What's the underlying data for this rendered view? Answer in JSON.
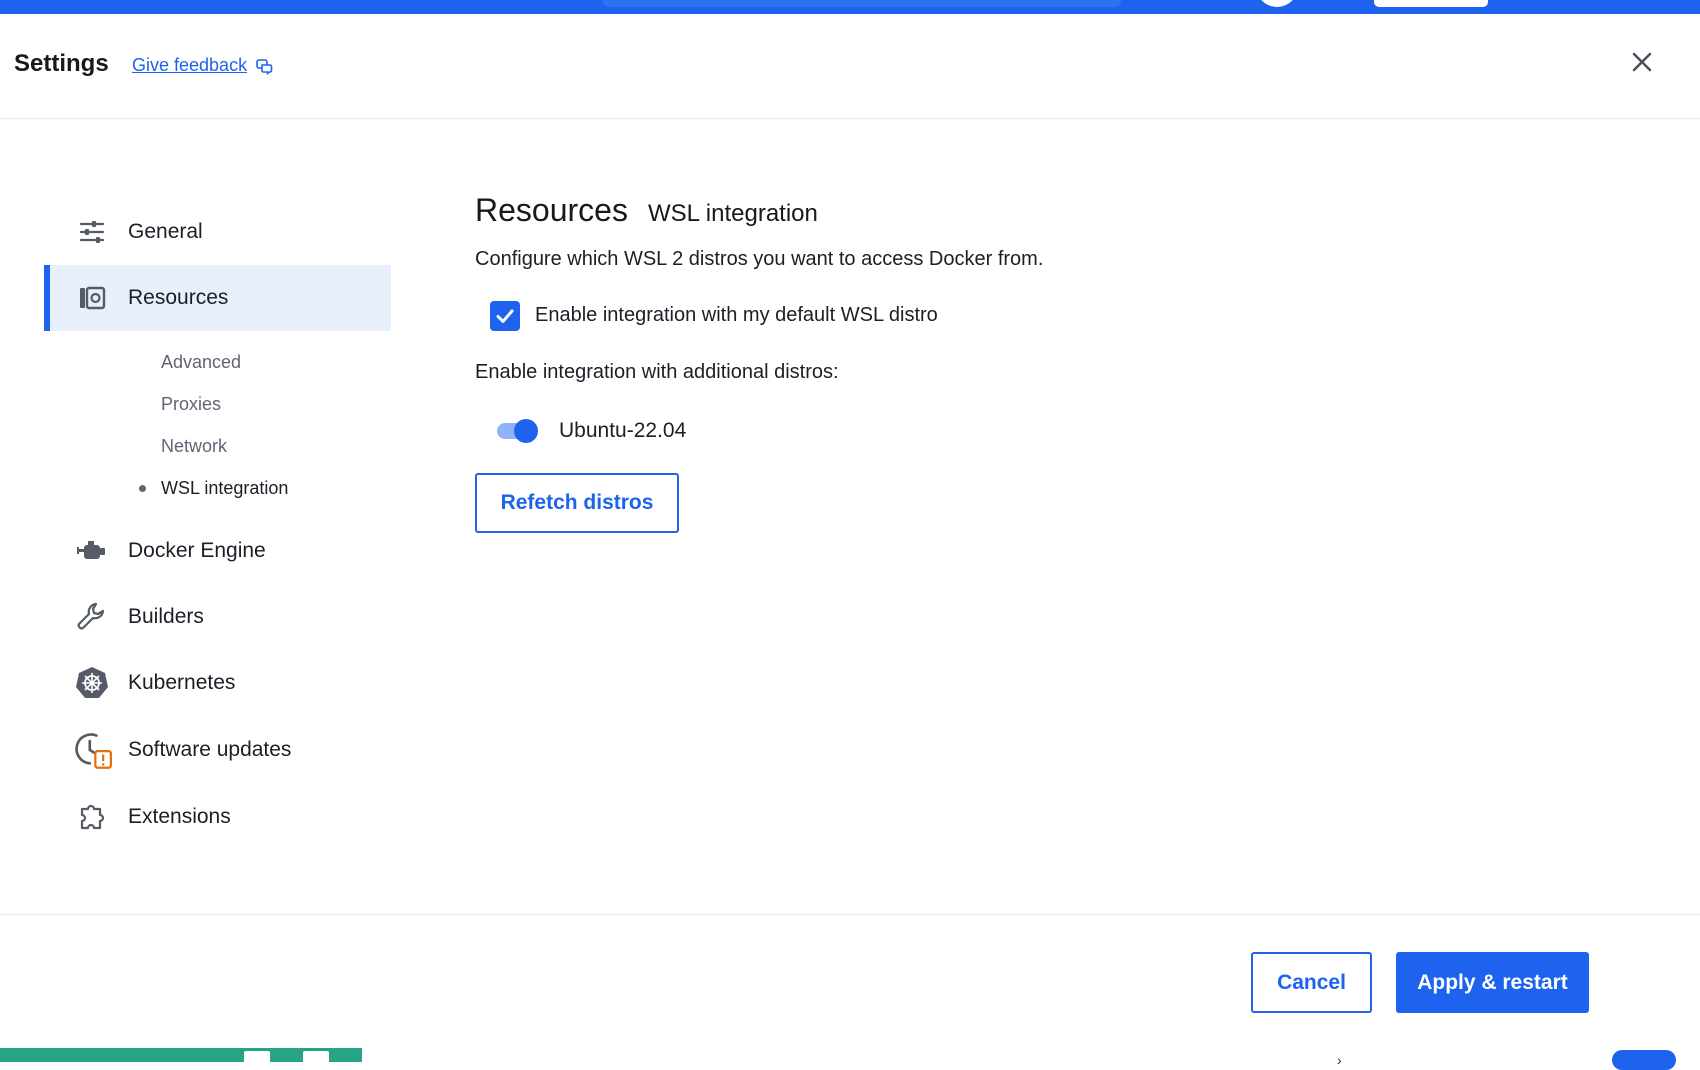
{
  "header": {
    "title": "Settings",
    "feedback_label": "Give feedback"
  },
  "sidebar": {
    "items": [
      {
        "label": "General",
        "icon": "sliders-icon"
      },
      {
        "label": "Resources",
        "icon": "resources-icon",
        "active": true
      },
      {
        "label": "Docker Engine",
        "icon": "engine-icon"
      },
      {
        "label": "Builders",
        "icon": "wrench-icon"
      },
      {
        "label": "Kubernetes",
        "icon": "kubernetes-icon"
      },
      {
        "label": "Software updates",
        "icon": "update-clock-icon"
      },
      {
        "label": "Extensions",
        "icon": "puzzle-icon"
      }
    ],
    "sub_items": [
      "Advanced",
      "Proxies",
      "Network",
      "WSL integration"
    ],
    "current_sub_item": "WSL integration"
  },
  "content": {
    "title": "Resources",
    "subtitle": "WSL integration",
    "description": "Configure which WSL 2 distros you want to access Docker from.",
    "default_distro": {
      "label": "Enable integration with my default WSL distro",
      "checked": true
    },
    "additional_label": "Enable integration with additional distros:",
    "distros": [
      {
        "name": "Ubuntu-22.04",
        "enabled": true
      }
    ],
    "refetch_label": "Refetch distros"
  },
  "footer": {
    "cancel_label": "Cancel",
    "apply_label": "Apply & restart"
  },
  "colors": {
    "accent": "#1d63ed",
    "engine_status": "#27a386",
    "warning": "#e8700a"
  }
}
